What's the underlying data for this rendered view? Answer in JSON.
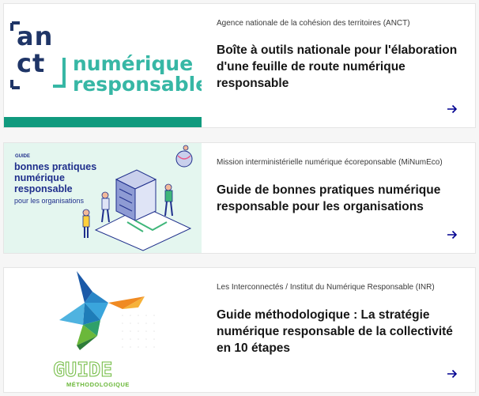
{
  "cards": [
    {
      "source": "Agence nationale de la cohésion des territoires (ANCT)",
      "title": "Boîte à outils nationale pour l'élaboration d'une feuille de route numérique responsable",
      "thumb": {
        "logo_line1": "an",
        "logo_line2": "ct",
        "brand_line1": "numérique",
        "brand_line2": "responsable"
      }
    },
    {
      "source": "Mission interministérielle numérique écoreponsable (MiNumEco)",
      "title": "Guide de bonnes pratiques numérique responsable pour les organisations",
      "thumb": {
        "label": "GUIDE",
        "heading": "bonnes pratiques numérique responsable",
        "subheading": "pour les organisations"
      }
    },
    {
      "source": "Les Interconnectés / Institut du Numérique Responsable (INR)",
      "title": "Guide méthodologique : La stratégie numérique responsable de la collectivité en 10 étapes",
      "thumb": {
        "heading": "GUIDE",
        "subheading": "MÉTHODOLOGIQUE"
      }
    }
  ],
  "colors": {
    "accent": "#000091",
    "anct_navy": "#1f3567",
    "anct_teal": "#37b7a5",
    "anct_bar": "#109a7e",
    "guide_blue": "#1f2f8c",
    "guide_bg": "#e4f6ef",
    "inr_green": "#6bb83a"
  },
  "icons": {
    "card_link": "arrow-right-icon"
  }
}
